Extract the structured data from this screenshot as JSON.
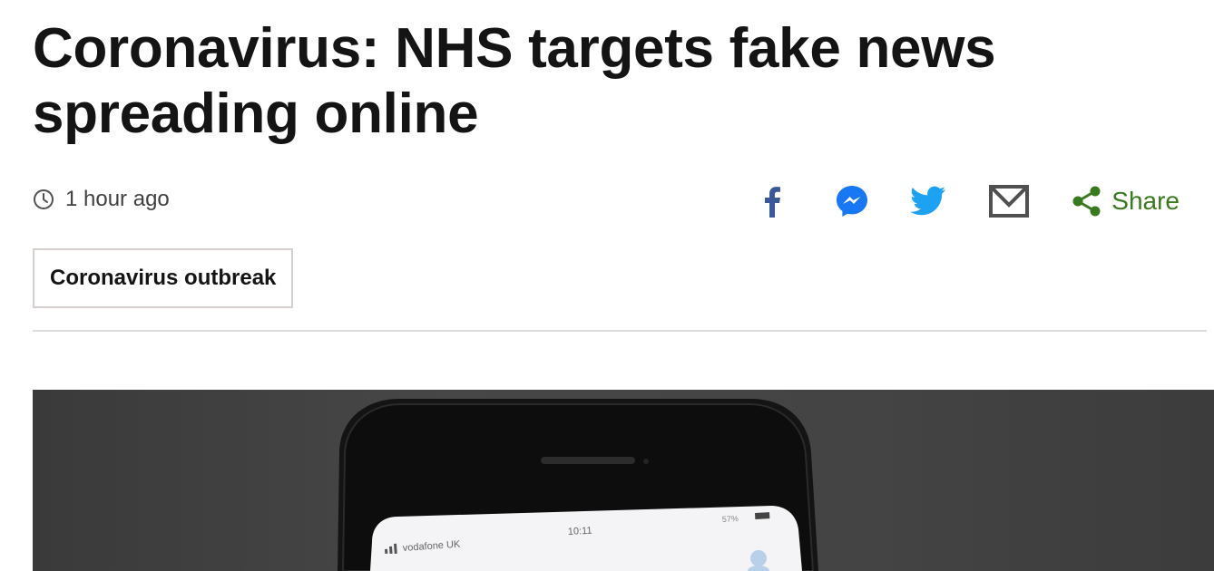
{
  "article": {
    "headline": "Coronavirus: NHS targets fake news spreading online",
    "timestamp": "1 hour ago",
    "topic_tag": "Coronavirus outbreak"
  },
  "share": {
    "label": "Share",
    "icons": [
      "facebook-icon",
      "messenger-icon",
      "twitter-icon",
      "email-icon",
      "share-icon"
    ]
  },
  "image": {
    "phone_carrier": "vodafone UK",
    "phone_time": "10:11",
    "phone_battery": "57%"
  },
  "colors": {
    "facebook": "#3b5998",
    "messenger": "#1877f2",
    "twitter": "#1da1f2",
    "email": "#404040",
    "share": "#3a7a1e",
    "headline": "#141414"
  }
}
